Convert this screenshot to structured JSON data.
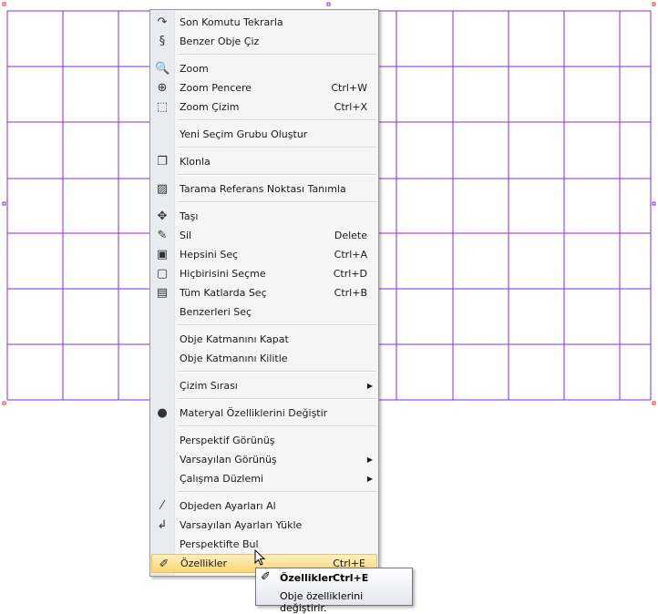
{
  "colors": {
    "grid": "#8a2be2",
    "highlight": "#fbd670"
  },
  "menu": {
    "items": [
      {
        "label": "Son Komutu Tekrarla",
        "icon": "repeat-icon",
        "glyph": "↷"
      },
      {
        "label": "Benzer Obje Çiz",
        "icon": "similar-object-icon",
        "glyph": "§"
      },
      {
        "sep": true
      },
      {
        "label": "Zoom",
        "icon": "zoom-icon",
        "glyph": "🔍"
      },
      {
        "label": "Zoom Pencere",
        "shortcut": "Ctrl+W",
        "icon": "zoom-window-icon",
        "glyph": "⊕"
      },
      {
        "label": "Zoom Çizim",
        "shortcut": "Ctrl+X",
        "icon": "zoom-extents-icon",
        "glyph": "⬚"
      },
      {
        "sep": true
      },
      {
        "label": "Yeni Seçim Grubu Oluştur"
      },
      {
        "sep": true
      },
      {
        "label": "Klonla",
        "icon": "clone-icon",
        "glyph": "❐"
      },
      {
        "sep": true
      },
      {
        "label": "Tarama Referans Noktası Tanımla",
        "icon": "hatch-icon",
        "glyph": "▨"
      },
      {
        "sep": true
      },
      {
        "label": "Taşı",
        "icon": "move-icon",
        "glyph": "✥"
      },
      {
        "label": "Sil",
        "shortcut": "Delete",
        "icon": "eraser-icon",
        "glyph": "✎"
      },
      {
        "label": "Hepsini Seç",
        "shortcut": "Ctrl+A",
        "icon": "select-all-icon",
        "glyph": "▣"
      },
      {
        "label": "Hiçbirisini Seçme",
        "shortcut": "Ctrl+D",
        "icon": "select-none-icon",
        "glyph": "▢"
      },
      {
        "label": "Tüm Katlarda Seç",
        "shortcut": "Ctrl+B",
        "icon": "select-all-floors-icon",
        "glyph": "▤"
      },
      {
        "label": "Benzerleri Seç"
      },
      {
        "sep": true
      },
      {
        "label": "Obje Katmanını Kapat"
      },
      {
        "label": "Obje Katmanını Kilitle"
      },
      {
        "sep": true
      },
      {
        "label": "Çizim Sırası",
        "submenu": true
      },
      {
        "sep": true
      },
      {
        "label": "Materyal Özelliklerini Değiştir",
        "icon": "material-icon",
        "glyph": "●"
      },
      {
        "sep": true
      },
      {
        "label": "Perspektif Görünüş"
      },
      {
        "label": "Varsayılan Görünüş",
        "submenu": true
      },
      {
        "label": "Çalışma Düzlemi",
        "submenu": true
      },
      {
        "sep": true
      },
      {
        "label": "Objeden Ayarları Al",
        "icon": "eyedropper-icon",
        "glyph": "⁄"
      },
      {
        "label": "Varsayılan Ayarları Yükle",
        "icon": "load-defaults-icon",
        "glyph": "↲"
      },
      {
        "label": "Perspektifte Bul"
      },
      {
        "label": "Özellikler",
        "shortcut": "Ctrl+E",
        "icon": "properties-icon",
        "glyph": "✐",
        "highlighted": true
      }
    ]
  },
  "tooltip": {
    "title": "Özellikler",
    "shortcut": "Ctrl+E",
    "description": "Obje özelliklerini değiştirir."
  }
}
